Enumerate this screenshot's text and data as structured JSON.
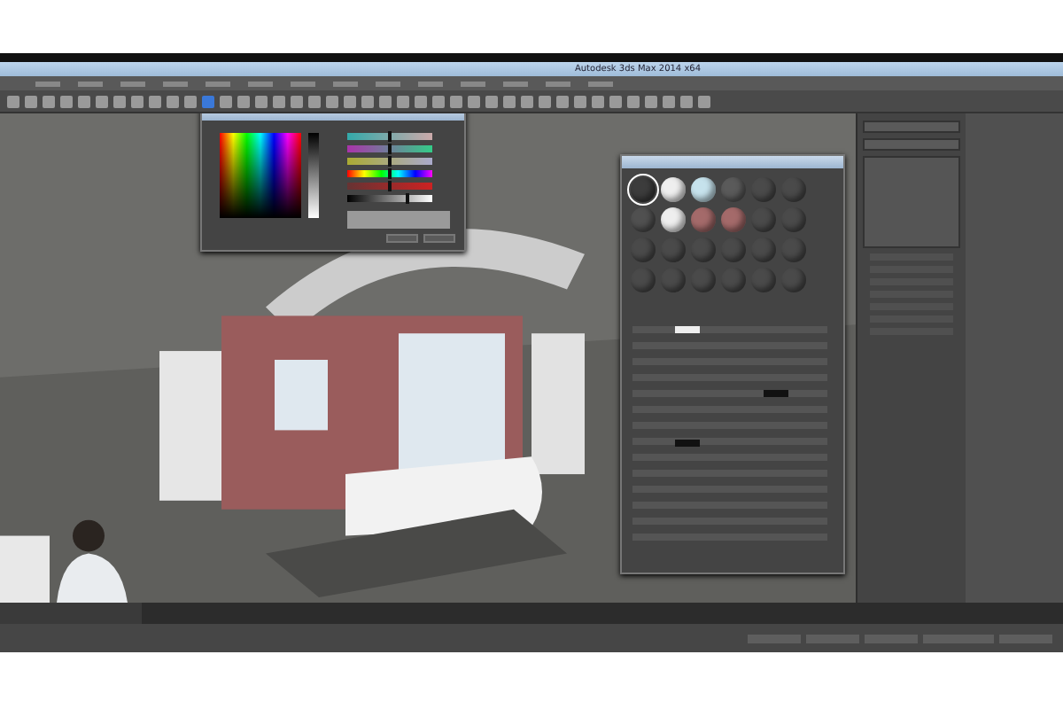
{
  "window": {
    "title": "Autodesk 3ds Max 2014 x64"
  },
  "color_picker": {
    "sliders": [
      {
        "level": 0.5
      },
      {
        "level": 0.5
      },
      {
        "level": 0.5
      },
      {
        "level": 0.5
      },
      {
        "level": 0.5
      },
      {
        "level": 0.7
      }
    ]
  },
  "material_editor": {
    "slots": [
      {
        "color": "#3c3c3c",
        "selected": true
      },
      {
        "color": "#eeeeee",
        "selected": false
      },
      {
        "color": "#c6e2ec",
        "selected": false
      },
      {
        "color": "#5a5a5a",
        "selected": false
      },
      {
        "color": "#4a4a4a",
        "selected": false
      },
      {
        "color": "#4a4a4a",
        "selected": false
      },
      {
        "color": "#505050",
        "selected": false
      },
      {
        "color": "#eeeeee",
        "selected": false
      },
      {
        "color": "#a46a6a",
        "selected": false
      },
      {
        "color": "#a46a6a",
        "selected": false
      },
      {
        "color": "#4a4a4a",
        "selected": false
      },
      {
        "color": "#4a4a4a",
        "selected": false
      },
      {
        "color": "#4a4a4a",
        "selected": false
      },
      {
        "color": "#4a4a4a",
        "selected": false
      },
      {
        "color": "#4a4a4a",
        "selected": false
      },
      {
        "color": "#4a4a4a",
        "selected": false
      },
      {
        "color": "#4a4a4a",
        "selected": false
      },
      {
        "color": "#4a4a4a",
        "selected": false
      },
      {
        "color": "#4a4a4a",
        "selected": false
      },
      {
        "color": "#4a4a4a",
        "selected": false
      },
      {
        "color": "#4a4a4a",
        "selected": false
      },
      {
        "color": "#4a4a4a",
        "selected": false
      },
      {
        "color": "#4a4a4a",
        "selected": false
      },
      {
        "color": "#4a4a4a",
        "selected": false
      }
    ]
  }
}
